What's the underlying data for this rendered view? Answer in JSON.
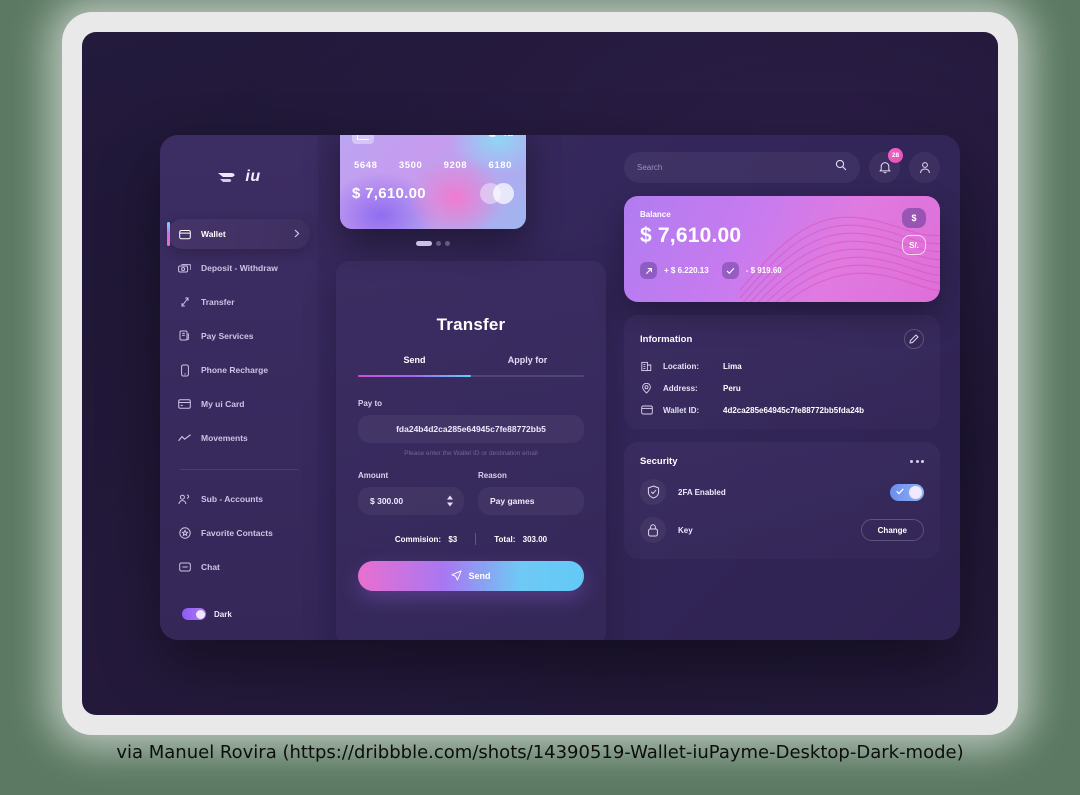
{
  "sidebar": {
    "logo_word": "iu",
    "items": [
      {
        "label": "Wallet",
        "icon": "wallet-icon",
        "active": true
      },
      {
        "label": "Deposit - Withdraw",
        "icon": "money-icon",
        "active": false
      },
      {
        "label": "Transfer",
        "icon": "transfer-icon",
        "active": false
      },
      {
        "label": "Pay Services",
        "icon": "services-icon",
        "active": false
      },
      {
        "label": "Phone Recharge",
        "icon": "phone-icon",
        "active": false
      },
      {
        "label": "My ui Card",
        "icon": "card-icon",
        "active": false
      },
      {
        "label": "Movements",
        "icon": "chart-icon",
        "active": false
      }
    ],
    "secondary_items": [
      {
        "label": "Sub - Accounts",
        "icon": "users-icon"
      },
      {
        "label": "Favorite Contacts",
        "icon": "star-contact-icon"
      },
      {
        "label": "Chat",
        "icon": "chat-icon"
      }
    ],
    "dark_mode_label": "Dark",
    "dark_mode_on": true
  },
  "topbar": {
    "search_placeholder": "Search",
    "search_value": "",
    "notification_count": "28"
  },
  "credit_card": {
    "logo_word": "iu",
    "number_groups": [
      "5648",
      "3500",
      "9208",
      "6180"
    ],
    "amount": "$ 7,610.00",
    "dots": 3,
    "active_dot": 0
  },
  "transfer": {
    "title": "Transfer",
    "tabs": [
      {
        "label": "Send",
        "active": true
      },
      {
        "label": "Apply for",
        "active": false
      }
    ],
    "payto_label": "Pay to",
    "payto_value": "fda24b4d2ca285e64945c7fe88772bb5",
    "payto_hint": "Please enter the Wallet ID or destination email",
    "amount_label": "Amount",
    "amount_value": "$ 300.00",
    "reason_label": "Reason",
    "reason_value": "Pay games",
    "commision_label": "Commision:",
    "commision_value": "$3",
    "total_label": "Total:",
    "total_value": "303.00",
    "send_label": "Send"
  },
  "balance": {
    "label": "Balance",
    "amount": "$ 7,610.00",
    "income": "+ $ 6.220.13",
    "outcome": "- $ 919.60",
    "currency_usd": "$",
    "currency_pen": "S/."
  },
  "information": {
    "title": "Information",
    "rows": [
      {
        "key": "Location:",
        "value": "Lima",
        "icon": "building-icon"
      },
      {
        "key": "Address:",
        "value": "Peru",
        "icon": "pin-icon"
      },
      {
        "key": "Wallet ID:",
        "value": "4d2ca285e64945c7fe88772bb5fda24b",
        "icon": "wallet-icon"
      }
    ]
  },
  "security": {
    "title": "Security",
    "twofa_label": "2FA Enabled",
    "twofa_enabled": true,
    "key_label": "Key",
    "change_label": "Change"
  },
  "caption": "via Manuel Rovira  (https://dribbble.com/shots/14390519-Wallet-iuPayme-Desktop-Dark-mode)",
  "colors": {
    "accent_pink": "#e96fcf",
    "accent_purple": "#a877f2",
    "accent_blue": "#62c9f7",
    "panel_bg": "#3e2f64",
    "sidebar_bg": "#3c2d63",
    "screen_bg": "#231a3d",
    "badge": "#f265c8"
  }
}
